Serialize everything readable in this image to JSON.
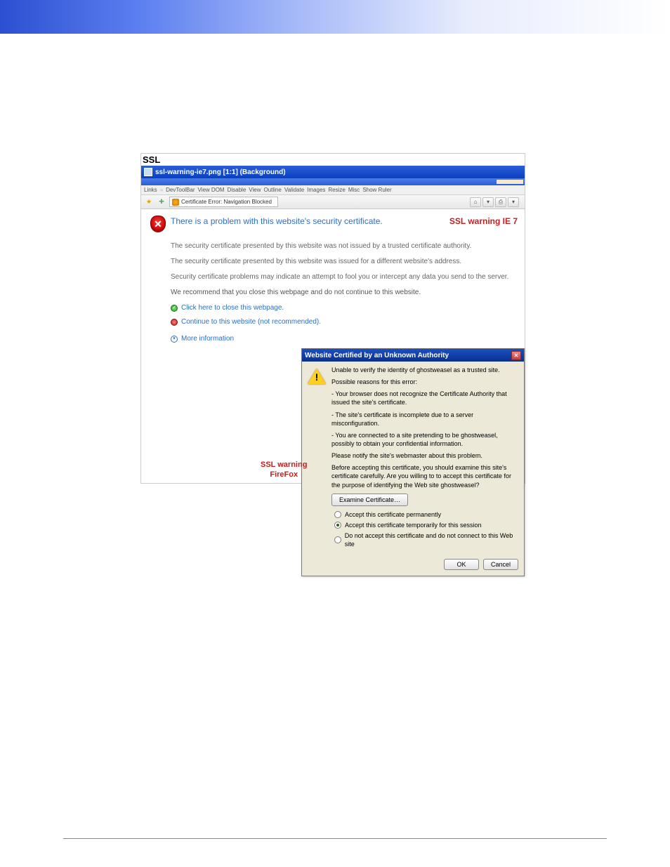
{
  "heading": "SSL",
  "editor": {
    "title": "ssl-warning-ie7.png [1:1] (Background)"
  },
  "devtoolbar": {
    "links": "Links",
    "items": [
      "DevToolBar",
      "View DOM",
      "Disable",
      "View",
      "Outline",
      "Validate",
      "Images",
      "Resize",
      "Misc",
      "Show Ruler"
    ]
  },
  "ie": {
    "address": "Certificate Error: Navigation Blocked",
    "label": "SSL warning IE 7",
    "heading": "There is a problem with this website's security certificate.",
    "p1": "The security certificate presented by this website was not issued by a trusted certificate authority.",
    "p2": "The security certificate presented by this website was issued for a different website's address.",
    "p3": "Security certificate problems may indicate an attempt to fool you or intercept any data you send to the server.",
    "p4": "We recommend that you close this webpage and do not continue to this website.",
    "link_close": "Click here to close this webpage.",
    "link_continue": "Continue to this website (not recommended).",
    "link_more": "More information"
  },
  "ff": {
    "title": "Website Certified by an Unknown Authority",
    "line1": "Unable to verify the identity of ghostweasel as a trusted site.",
    "line2": "Possible reasons for this error:",
    "reason1": "- Your browser does not recognize the Certificate Authority that issued the site's certificate.",
    "reason2": "- The site's certificate is incomplete due to a server misconfiguration.",
    "reason3": "- You are connected to a site pretending to be ghostweasel, possibly to obtain your confidential information.",
    "line3": "Please notify the site's webmaster about this problem.",
    "line4": "Before accepting this certificate, you should examine this site's certificate carefully. Are you willing to to accept this certificate for the purpose of identifying the Web site ghostweasel?",
    "examine": "Examine Certificate…",
    "radio1": "Accept this certificate permanently",
    "radio2": "Accept this certificate temporarily for this session",
    "radio3": "Do not accept this certificate and do not connect to this Web site",
    "ok": "OK",
    "cancel": "Cancel",
    "label_line1": "SSL warning",
    "label_line2": "FireFox"
  }
}
